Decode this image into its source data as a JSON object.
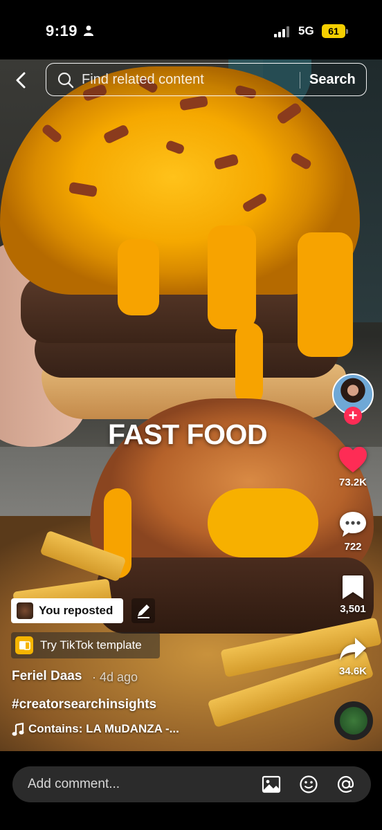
{
  "status_bar": {
    "time": "9:19",
    "network": "5G",
    "battery": "61",
    "battery_color": "#f5cf00"
  },
  "search": {
    "placeholder": "Find related content",
    "button_label": "Search"
  },
  "video": {
    "overlay_text": "FAST FOOD"
  },
  "actions": {
    "likes": "73.2K",
    "comments": "722",
    "saves": "3,501",
    "shares": "34.6K",
    "like_color": "#fe2c55"
  },
  "post": {
    "repost_label": "You reposted",
    "template_label": "Try TikTok template",
    "author": "Feriel Daas",
    "age": "· 4d ago",
    "hashtag": "#creatorsearchinsights",
    "music": "Contains: LA MuDANZA -..."
  },
  "comment_bar": {
    "placeholder": "Add comment..."
  },
  "icons": [
    "person-icon",
    "signal-icon",
    "back-icon",
    "search-icon",
    "follow-plus-icon",
    "heart-icon",
    "comment-icon",
    "bookmark-icon",
    "share-icon",
    "edit-icon",
    "template-icon",
    "music-note-icon",
    "image-icon",
    "emoji-icon",
    "mention-icon"
  ]
}
